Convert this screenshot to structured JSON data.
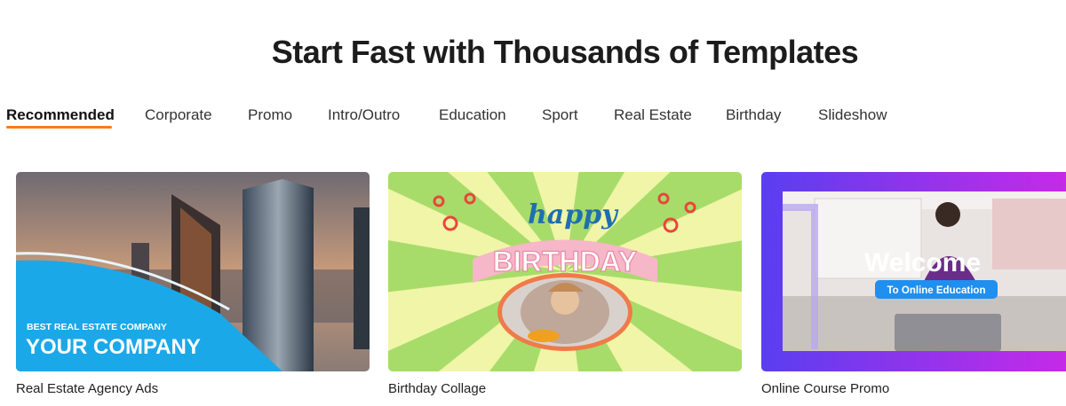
{
  "page": {
    "title": "Start Fast with Thousands of Templates"
  },
  "tabs": [
    {
      "label": "Recommended",
      "active": true
    },
    {
      "label": "Corporate",
      "active": false
    },
    {
      "label": "Promo",
      "active": false
    },
    {
      "label": "Intro/Outro",
      "active": false
    },
    {
      "label": "Education",
      "active": false
    },
    {
      "label": "Sport",
      "active": false
    },
    {
      "label": "Real Estate",
      "active": false
    },
    {
      "label": "Birthday",
      "active": false
    },
    {
      "label": "Slideshow",
      "active": false
    }
  ],
  "cards": [
    {
      "caption": "Real Estate Agency Ads",
      "overlay_small": "BEST REAL ESTATE COMPANY",
      "overlay_big": "YOUR COMPANY"
    },
    {
      "caption": "Birthday Collage",
      "overlay_script": "happy",
      "overlay_big": "BIRTHDAY"
    },
    {
      "caption": "Online Course Promo",
      "overlay_big": "Welcome",
      "overlay_pill": "To Online Education"
    }
  ],
  "colors": {
    "accent": "#ff7a1a",
    "real_estate_blue": "#1aa8e8",
    "promo_purple": "#a12ef0"
  }
}
